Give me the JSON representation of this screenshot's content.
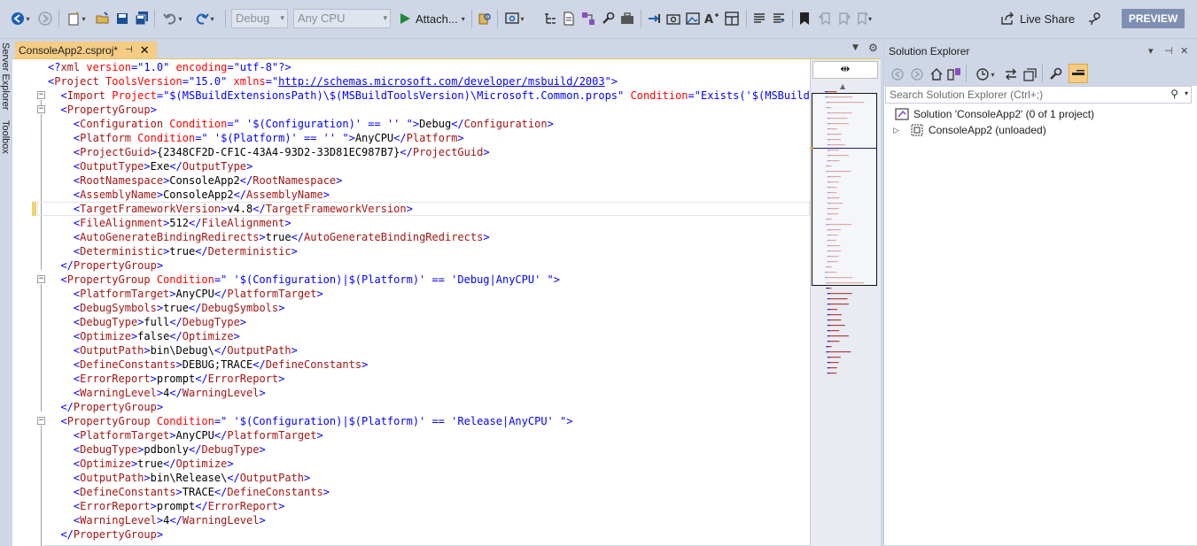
{
  "toolbar": {
    "debug_config": "Debug",
    "platform": "Any CPU",
    "attach_label": "Attach...",
    "live_share_label": "Live Share",
    "preview_label": "PREVIEW"
  },
  "side_tabs": [
    "Server Explorer",
    "Toolbox"
  ],
  "document_tab": {
    "title": "ConsoleApp2.csproj*"
  },
  "editor": {
    "lines": [
      [
        [
          "p",
          "<?"
        ],
        [
          "t",
          "xml"
        ],
        [
          "a",
          " version"
        ],
        [
          "p",
          "=\""
        ],
        [
          "s",
          "1.0"
        ],
        [
          "p",
          "\""
        ],
        [
          "a",
          " encoding"
        ],
        [
          "p",
          "=\""
        ],
        [
          "s",
          "utf-8"
        ],
        [
          "p",
          "\"?>"
        ]
      ],
      [
        [
          "p",
          "<"
        ],
        [
          "t",
          "Project"
        ],
        [
          "a",
          " ToolsVersion"
        ],
        [
          "p",
          "=\""
        ],
        [
          "s",
          "15.0"
        ],
        [
          "p",
          "\""
        ],
        [
          "a",
          " xmlns"
        ],
        [
          "p",
          "=\""
        ],
        [
          "u",
          "http://schemas.microsoft.com/developer/msbuild/2003"
        ],
        [
          "p",
          "\">"
        ]
      ],
      [
        [
          "x",
          "  "
        ],
        [
          "p",
          "<"
        ],
        [
          "t",
          "Import"
        ],
        [
          "a",
          " Project"
        ],
        [
          "p",
          "=\""
        ],
        [
          "s",
          "$(MSBuildExtensionsPath)\\$(MSBuildToolsVersion)\\Microsoft.Common.props"
        ],
        [
          "p",
          "\""
        ],
        [
          "a",
          " Condition"
        ],
        [
          "p",
          "=\""
        ],
        [
          "s",
          "Exists('$(MSBuildExte"
        ]
      ],
      [
        [
          "x",
          "  "
        ],
        [
          "p",
          "<"
        ],
        [
          "t",
          "PropertyGroup"
        ],
        [
          "p",
          ">"
        ]
      ],
      [
        [
          "x",
          "    "
        ],
        [
          "p",
          "<"
        ],
        [
          "t",
          "Configuration"
        ],
        [
          "a",
          " Condition"
        ],
        [
          "p",
          "=\""
        ],
        [
          "s",
          " '$(Configuration)' == '' "
        ],
        [
          "p",
          "\">"
        ],
        [
          "x",
          "Debug"
        ],
        [
          "p",
          "</"
        ],
        [
          "t",
          "Configuration"
        ],
        [
          "p",
          ">"
        ]
      ],
      [
        [
          "x",
          "    "
        ],
        [
          "p",
          "<"
        ],
        [
          "t",
          "Platform"
        ],
        [
          "a",
          " Condition"
        ],
        [
          "p",
          "=\""
        ],
        [
          "s",
          " '$(Platform)' == '' "
        ],
        [
          "p",
          "\">"
        ],
        [
          "x",
          "AnyCPU"
        ],
        [
          "p",
          "</"
        ],
        [
          "t",
          "Platform"
        ],
        [
          "p",
          ">"
        ]
      ],
      [
        [
          "x",
          "    "
        ],
        [
          "p",
          "<"
        ],
        [
          "t",
          "ProjectGuid"
        ],
        [
          "p",
          ">"
        ],
        [
          "x",
          "{2348CF2D-CF1C-43A4-93D2-33D81EC987B7}"
        ],
        [
          "p",
          "</"
        ],
        [
          "t",
          "ProjectGuid"
        ],
        [
          "p",
          ">"
        ]
      ],
      [
        [
          "x",
          "    "
        ],
        [
          "p",
          "<"
        ],
        [
          "t",
          "OutputType"
        ],
        [
          "p",
          ">"
        ],
        [
          "x",
          "Exe"
        ],
        [
          "p",
          "</"
        ],
        [
          "t",
          "OutputType"
        ],
        [
          "p",
          ">"
        ]
      ],
      [
        [
          "x",
          "    "
        ],
        [
          "p",
          "<"
        ],
        [
          "t",
          "RootNamespace"
        ],
        [
          "p",
          ">"
        ],
        [
          "x",
          "ConsoleApp2"
        ],
        [
          "p",
          "</"
        ],
        [
          "t",
          "RootNamespace"
        ],
        [
          "p",
          ">"
        ]
      ],
      [
        [
          "x",
          "    "
        ],
        [
          "p",
          "<"
        ],
        [
          "t",
          "AssemblyName"
        ],
        [
          "p",
          ">"
        ],
        [
          "x",
          "ConsoleApp2"
        ],
        [
          "p",
          "</"
        ],
        [
          "t",
          "AssemblyName"
        ],
        [
          "p",
          ">"
        ]
      ],
      [
        [
          "x",
          "    "
        ],
        [
          "p",
          "<"
        ],
        [
          "t",
          "TargetFrameworkVersion"
        ],
        [
          "p",
          ">"
        ],
        [
          "x",
          "v4.8"
        ],
        [
          "p",
          "</"
        ],
        [
          "t",
          "TargetFrameworkVersion"
        ],
        [
          "p",
          ">"
        ]
      ],
      [
        [
          "x",
          "    "
        ],
        [
          "p",
          "<"
        ],
        [
          "t",
          "FileAlignment"
        ],
        [
          "p",
          ">"
        ],
        [
          "x",
          "512"
        ],
        [
          "p",
          "</"
        ],
        [
          "t",
          "FileAlignment"
        ],
        [
          "p",
          ">"
        ]
      ],
      [
        [
          "x",
          "    "
        ],
        [
          "p",
          "<"
        ],
        [
          "t",
          "AutoGenerateBindingRedirects"
        ],
        [
          "p",
          ">"
        ],
        [
          "x",
          "true"
        ],
        [
          "p",
          "</"
        ],
        [
          "t",
          "AutoGenerateBindingRedirects"
        ],
        [
          "p",
          ">"
        ]
      ],
      [
        [
          "x",
          "    "
        ],
        [
          "p",
          "<"
        ],
        [
          "t",
          "Deterministic"
        ],
        [
          "p",
          ">"
        ],
        [
          "x",
          "true"
        ],
        [
          "p",
          "</"
        ],
        [
          "t",
          "Deterministic"
        ],
        [
          "p",
          ">"
        ]
      ],
      [
        [
          "x",
          "  "
        ],
        [
          "p",
          "</"
        ],
        [
          "t",
          "PropertyGroup"
        ],
        [
          "p",
          ">"
        ]
      ],
      [
        [
          "x",
          "  "
        ],
        [
          "p",
          "<"
        ],
        [
          "t",
          "PropertyGroup"
        ],
        [
          "a",
          " Condition"
        ],
        [
          "p",
          "=\""
        ],
        [
          "s",
          " '$(Configuration)|$(Platform)' == 'Debug|AnyCPU' "
        ],
        [
          "p",
          "\">"
        ]
      ],
      [
        [
          "x",
          "    "
        ],
        [
          "p",
          "<"
        ],
        [
          "t",
          "PlatformTarget"
        ],
        [
          "p",
          ">"
        ],
        [
          "x",
          "AnyCPU"
        ],
        [
          "p",
          "</"
        ],
        [
          "t",
          "PlatformTarget"
        ],
        [
          "p",
          ">"
        ]
      ],
      [
        [
          "x",
          "    "
        ],
        [
          "p",
          "<"
        ],
        [
          "t",
          "DebugSymbols"
        ],
        [
          "p",
          ">"
        ],
        [
          "x",
          "true"
        ],
        [
          "p",
          "</"
        ],
        [
          "t",
          "DebugSymbols"
        ],
        [
          "p",
          ">"
        ]
      ],
      [
        [
          "x",
          "    "
        ],
        [
          "p",
          "<"
        ],
        [
          "t",
          "DebugType"
        ],
        [
          "p",
          ">"
        ],
        [
          "x",
          "full"
        ],
        [
          "p",
          "</"
        ],
        [
          "t",
          "DebugType"
        ],
        [
          "p",
          ">"
        ]
      ],
      [
        [
          "x",
          "    "
        ],
        [
          "p",
          "<"
        ],
        [
          "t",
          "Optimize"
        ],
        [
          "p",
          ">"
        ],
        [
          "x",
          "false"
        ],
        [
          "p",
          "</"
        ],
        [
          "t",
          "Optimize"
        ],
        [
          "p",
          ">"
        ]
      ],
      [
        [
          "x",
          "    "
        ],
        [
          "p",
          "<"
        ],
        [
          "t",
          "OutputPath"
        ],
        [
          "p",
          ">"
        ],
        [
          "x",
          "bin\\Debug\\"
        ],
        [
          "p",
          "</"
        ],
        [
          "t",
          "OutputPath"
        ],
        [
          "p",
          ">"
        ]
      ],
      [
        [
          "x",
          "    "
        ],
        [
          "p",
          "<"
        ],
        [
          "t",
          "DefineConstants"
        ],
        [
          "p",
          ">"
        ],
        [
          "x",
          "DEBUG;TRACE"
        ],
        [
          "p",
          "</"
        ],
        [
          "t",
          "DefineConstants"
        ],
        [
          "p",
          ">"
        ]
      ],
      [
        [
          "x",
          "    "
        ],
        [
          "p",
          "<"
        ],
        [
          "t",
          "ErrorReport"
        ],
        [
          "p",
          ">"
        ],
        [
          "x",
          "prompt"
        ],
        [
          "p",
          "</"
        ],
        [
          "t",
          "ErrorReport"
        ],
        [
          "p",
          ">"
        ]
      ],
      [
        [
          "x",
          "    "
        ],
        [
          "p",
          "<"
        ],
        [
          "t",
          "WarningLevel"
        ],
        [
          "p",
          ">"
        ],
        [
          "x",
          "4"
        ],
        [
          "p",
          "</"
        ],
        [
          "t",
          "WarningLevel"
        ],
        [
          "p",
          ">"
        ]
      ],
      [
        [
          "x",
          "  "
        ],
        [
          "p",
          "</"
        ],
        [
          "t",
          "PropertyGroup"
        ],
        [
          "p",
          ">"
        ]
      ],
      [
        [
          "x",
          "  "
        ],
        [
          "p",
          "<"
        ],
        [
          "t",
          "PropertyGroup"
        ],
        [
          "a",
          " Condition"
        ],
        [
          "p",
          "=\""
        ],
        [
          "s",
          " '$(Configuration)|$(Platform)' == 'Release|AnyCPU' "
        ],
        [
          "p",
          "\">"
        ]
      ],
      [
        [
          "x",
          "    "
        ],
        [
          "p",
          "<"
        ],
        [
          "t",
          "PlatformTarget"
        ],
        [
          "p",
          ">"
        ],
        [
          "x",
          "AnyCPU"
        ],
        [
          "p",
          "</"
        ],
        [
          "t",
          "PlatformTarget"
        ],
        [
          "p",
          ">"
        ]
      ],
      [
        [
          "x",
          "    "
        ],
        [
          "p",
          "<"
        ],
        [
          "t",
          "DebugType"
        ],
        [
          "p",
          ">"
        ],
        [
          "x",
          "pdbonly"
        ],
        [
          "p",
          "</"
        ],
        [
          "t",
          "DebugType"
        ],
        [
          "p",
          ">"
        ]
      ],
      [
        [
          "x",
          "    "
        ],
        [
          "p",
          "<"
        ],
        [
          "t",
          "Optimize"
        ],
        [
          "p",
          ">"
        ],
        [
          "x",
          "true"
        ],
        [
          "p",
          "</"
        ],
        [
          "t",
          "Optimize"
        ],
        [
          "p",
          ">"
        ]
      ],
      [
        [
          "x",
          "    "
        ],
        [
          "p",
          "<"
        ],
        [
          "t",
          "OutputPath"
        ],
        [
          "p",
          ">"
        ],
        [
          "x",
          "bin\\Release\\"
        ],
        [
          "p",
          "</"
        ],
        [
          "t",
          "OutputPath"
        ],
        [
          "p",
          ">"
        ]
      ],
      [
        [
          "x",
          "    "
        ],
        [
          "p",
          "<"
        ],
        [
          "t",
          "DefineConstants"
        ],
        [
          "p",
          ">"
        ],
        [
          "x",
          "TRACE"
        ],
        [
          "p",
          "</"
        ],
        [
          "t",
          "DefineConstants"
        ],
        [
          "p",
          ">"
        ]
      ],
      [
        [
          "x",
          "    "
        ],
        [
          "p",
          "<"
        ],
        [
          "t",
          "ErrorReport"
        ],
        [
          "p",
          ">"
        ],
        [
          "x",
          "prompt"
        ],
        [
          "p",
          "</"
        ],
        [
          "t",
          "ErrorReport"
        ],
        [
          "p",
          ">"
        ]
      ],
      [
        [
          "x",
          "    "
        ],
        [
          "p",
          "<"
        ],
        [
          "t",
          "WarningLevel"
        ],
        [
          "p",
          ">"
        ],
        [
          "x",
          "4"
        ],
        [
          "p",
          "</"
        ],
        [
          "t",
          "WarningLevel"
        ],
        [
          "p",
          ">"
        ]
      ],
      [
        [
          "x",
          "  "
        ],
        [
          "p",
          "</"
        ],
        [
          "t",
          "PropertyGroup"
        ],
        [
          "p",
          ">"
        ]
      ]
    ]
  },
  "solution_explorer": {
    "title": "Solution Explorer",
    "search_placeholder": "Search Solution Explorer (Ctrl+;)",
    "solution_label": "Solution 'ConsoleApp2' (0 of 1 project)",
    "project_label": "ConsoleApp2 (unloaded)"
  },
  "colors": {
    "accent": "#f5cc84",
    "tag": "#a31515",
    "attribute": "#ff0000",
    "punctuation": "#0000ff",
    "preview": "#7f8fb3"
  }
}
